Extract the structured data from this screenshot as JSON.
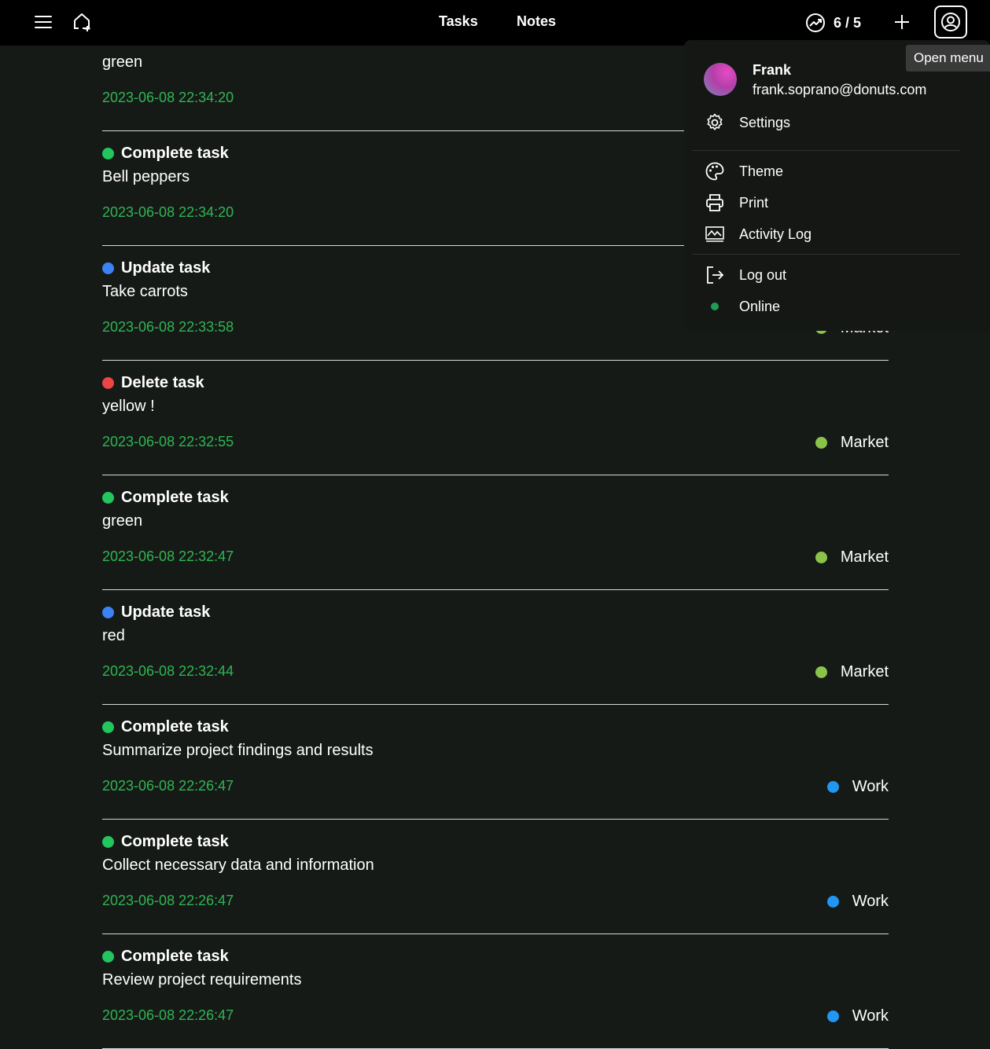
{
  "nav": {
    "tasks": "Tasks",
    "notes": "Notes",
    "progress": "6 / 5"
  },
  "tooltip": "Open menu",
  "colors": {
    "complete": "#22c55e",
    "update": "#3b82f6",
    "delete": "#ef4444",
    "market": "#8bc34a",
    "work": "#2196f3",
    "timestamp": "#2fb552"
  },
  "feed": [
    {
      "action": "",
      "dot": "",
      "name": "green",
      "time": "2023-06-08 22:34:20",
      "category": "",
      "cat_dot": ""
    },
    {
      "action": "Complete task",
      "dot": "#22c55e",
      "name": "Bell peppers",
      "time": "2023-06-08 22:34:20",
      "category": "",
      "cat_dot": ""
    },
    {
      "action": "Update task",
      "dot": "#3b82f6",
      "name": "Take carrots",
      "time": "2023-06-08 22:33:58",
      "category": "Market",
      "cat_dot": "#8bc34a"
    },
    {
      "action": "Delete task",
      "dot": "#ef4444",
      "name": "yellow !",
      "time": "2023-06-08 22:32:55",
      "category": "Market",
      "cat_dot": "#8bc34a"
    },
    {
      "action": "Complete task",
      "dot": "#22c55e",
      "name": "green",
      "time": "2023-06-08 22:32:47",
      "category": "Market",
      "cat_dot": "#8bc34a"
    },
    {
      "action": "Update task",
      "dot": "#3b82f6",
      "name": "red",
      "time": "2023-06-08 22:32:44",
      "category": "Market",
      "cat_dot": "#8bc34a"
    },
    {
      "action": "Complete task",
      "dot": "#22c55e",
      "name": "Summarize project findings and results",
      "time": "2023-06-08 22:26:47",
      "category": "Work",
      "cat_dot": "#2196f3"
    },
    {
      "action": "Complete task",
      "dot": "#22c55e",
      "name": "Collect necessary data and information",
      "time": "2023-06-08 22:26:47",
      "category": "Work",
      "cat_dot": "#2196f3"
    },
    {
      "action": "Complete task",
      "dot": "#22c55e",
      "name": "Review project requirements",
      "time": "2023-06-08 22:26:47",
      "category": "Work",
      "cat_dot": "#2196f3"
    }
  ],
  "menu": {
    "user": {
      "name": "Frank",
      "email": "frank.soprano@donuts.com"
    },
    "settings": "Settings",
    "theme": "Theme",
    "print": "Print",
    "activity_log": "Activity Log",
    "log_out": "Log out",
    "status": "Online",
    "status_color": "#1f9d57"
  }
}
